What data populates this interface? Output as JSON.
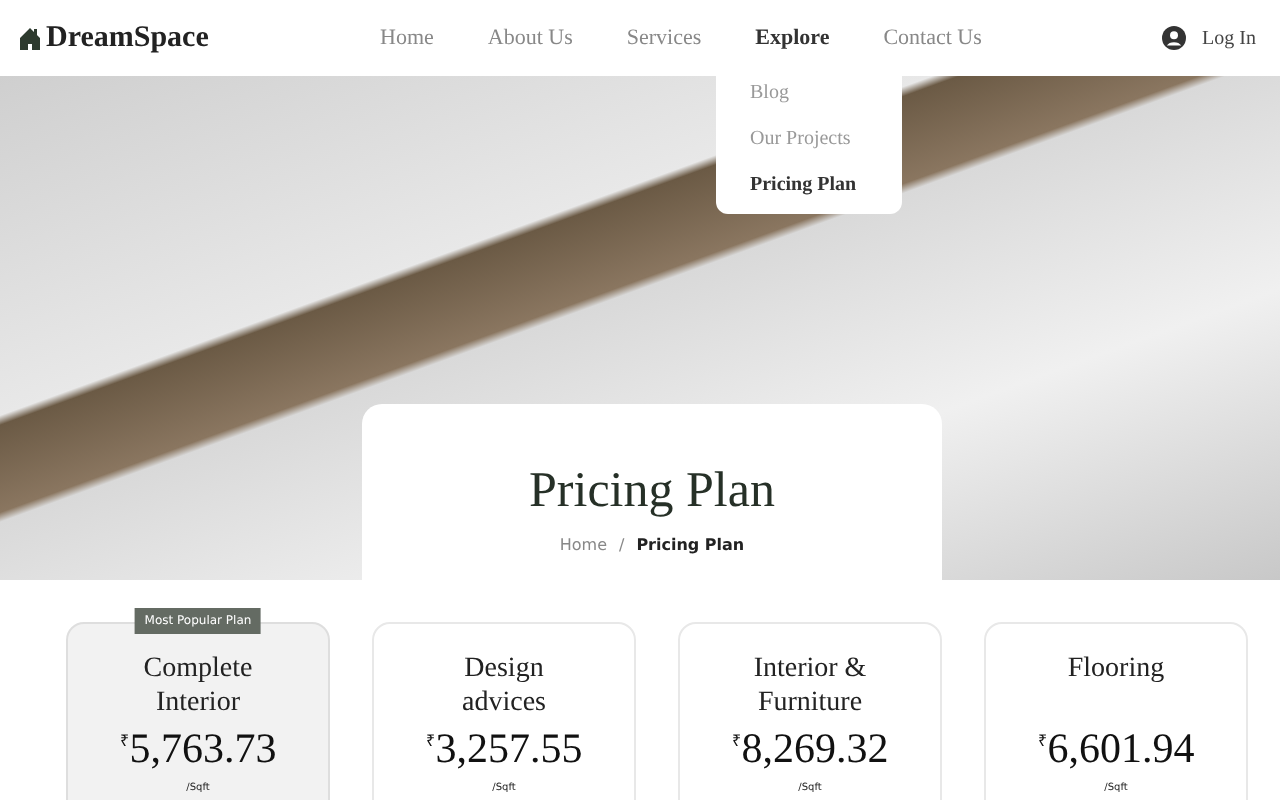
{
  "brand": "DreamSpace",
  "nav": [
    {
      "label": "Home",
      "selected": false
    },
    {
      "label": "About Us",
      "selected": false
    },
    {
      "label": "Services",
      "selected": false
    },
    {
      "label": "Explore",
      "selected": true
    },
    {
      "label": "Contact Us",
      "selected": false
    }
  ],
  "login": "Log In",
  "dropdown": [
    {
      "label": "Blog",
      "selected": false
    },
    {
      "label": "Our Projects",
      "selected": false
    },
    {
      "label": "Pricing Plan",
      "selected": true
    }
  ],
  "page_title": "Pricing Plan",
  "breadcrumb": [
    "Home",
    "/",
    "Pricing Plan"
  ],
  "plans": [
    {
      "name": "Complete Interior",
      "price": "$^{₹}$5,763.73",
      "unit": "/Sqft",
      "featured": true,
      "badge": "Most Popular Plan"
    },
    {
      "name": "Design advices",
      "price": "$^{₹}$3,257.55",
      "unit": "/Sqft",
      "featured": false
    },
    {
      "name": "Interior & Furniture",
      "price": "$^{₹}$8,269.32",
      "unit": "/Sqft",
      "featured": false
    },
    {
      "name": "Flooring",
      "price": "$^{₹}$6,601.94",
      "unit": "/Sqft",
      "featured": false
    }
  ]
}
